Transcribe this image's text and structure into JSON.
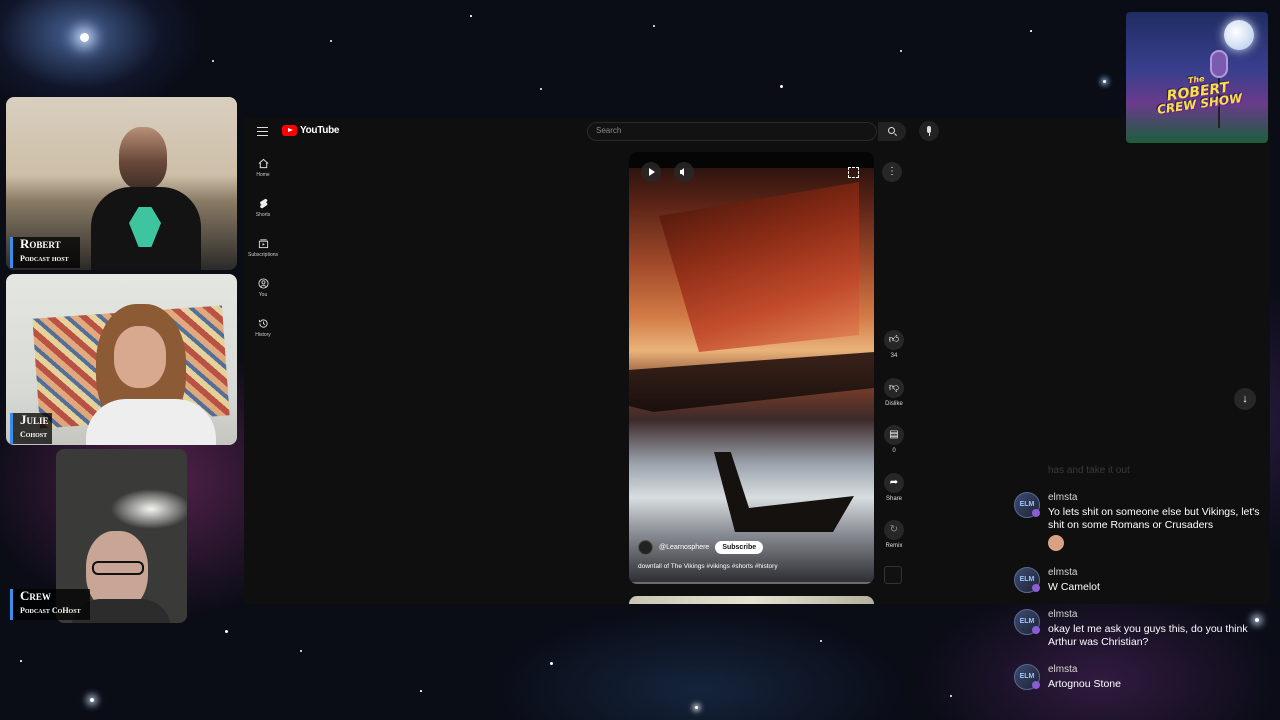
{
  "youtube": {
    "logo_text": "YouTube",
    "search_placeholder": "Search",
    "nav": [
      {
        "label": "Home",
        "icon": "home-icon"
      },
      {
        "label": "Shorts",
        "icon": "shorts-icon"
      },
      {
        "label": "Subscriptions",
        "icon": "subscriptions-icon"
      },
      {
        "label": "You",
        "icon": "you-icon"
      },
      {
        "label": "History",
        "icon": "history-icon"
      }
    ],
    "short": {
      "channel": "@Learnosphere",
      "subscribe_label": "Subscribe",
      "title": "downfall of The Vikings #vikings #shorts #history"
    },
    "actions": {
      "like_count": "34",
      "dislike_label": "Dislike",
      "comment_count": "0",
      "share_label": "Share",
      "remix_label": "Remix"
    }
  },
  "cameras": [
    {
      "name": "Robert",
      "role": "Podcast host"
    },
    {
      "name": "Julie",
      "role": "Cohost"
    },
    {
      "name": "Crew",
      "role": "Podcast CoHost"
    }
  ],
  "show_logo": {
    "line1": "The",
    "line2": "ROBERT",
    "line3": "CREW SHOW"
  },
  "chat": {
    "faded_text": "has and take it out",
    "messages": [
      {
        "user": "elmsta",
        "text": "Yo lets shit on someone else but Vikings, let's shit on some Romans or Crusaders"
      },
      {
        "user": "elmsta",
        "text": "W Camelot"
      },
      {
        "user": "elmsta",
        "text": "okay let me ask you guys this, do you think Arthur was Christian?"
      },
      {
        "user": "elmsta",
        "text": "Artognou Stone"
      }
    ]
  },
  "colors": {
    "accent_blue": "#3a8eea",
    "youtube_red": "#ff0000",
    "logo_yellow": "#f3e24a"
  }
}
